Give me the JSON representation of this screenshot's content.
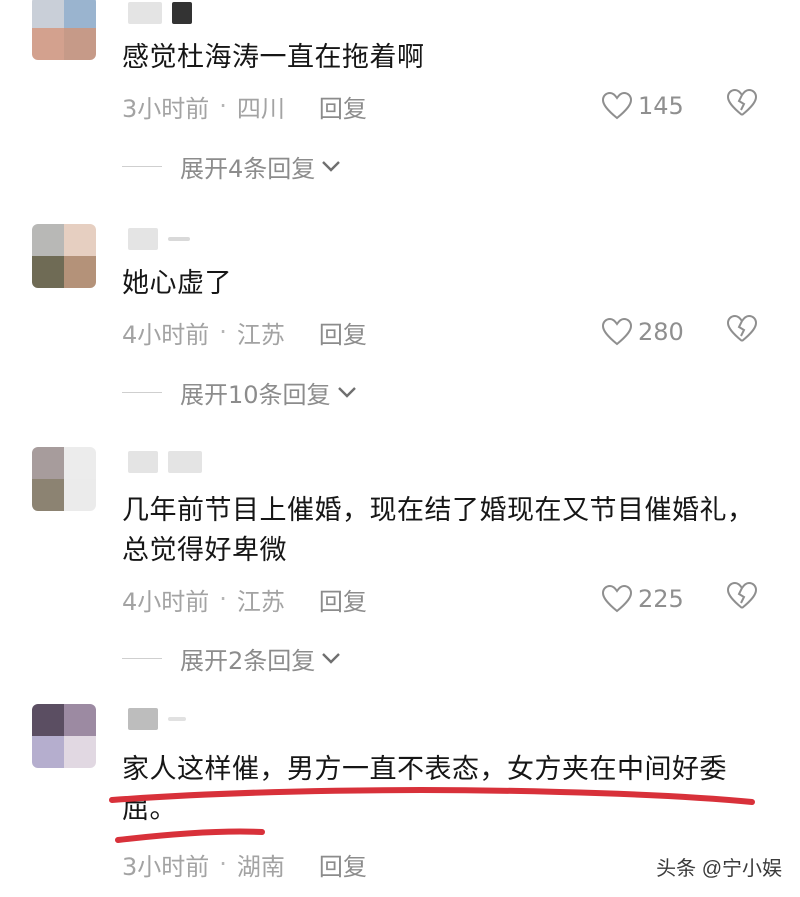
{
  "comments": [
    {
      "text": "感觉杜海涛一直在拖着啊",
      "time": "3小时前",
      "location": "四川",
      "reply_label": "回复",
      "likes": "145",
      "expand_label": "展开4条回复",
      "avatar_colors": [
        "#c9cfd8",
        "#9ab4cf",
        "#d3a18e",
        "#c69a88"
      ]
    },
    {
      "text": "她心虚了",
      "time": "4小时前",
      "location": "江苏",
      "reply_label": "回复",
      "likes": "280",
      "expand_label": "展开10条回复",
      "avatar_colors": [
        "#b8b8b6",
        "#e6cfc1",
        "#6f6b55",
        "#b49279"
      ]
    },
    {
      "text": "几年前节目上催婚，现在结了婚现在又节目催婚礼，总觉得好卑微",
      "time": "4小时前",
      "location": "江苏",
      "reply_label": "回复",
      "likes": "225",
      "expand_label": "展开2条回复",
      "avatar_colors": [
        "#a79c9c",
        "#ececec",
        "#8c8372",
        "#ebebeb"
      ]
    },
    {
      "text": "家人这样催，男方一直不表态，女方夹在中间好委屈。",
      "time": "3小时前",
      "location": "湖南",
      "reply_label": "回复",
      "avatar_colors": [
        "#5b4e62",
        "#9c8aa2",
        "#b5aece",
        "#e1d8e2"
      ]
    }
  ],
  "watermark": "头条 @宁小娱",
  "colors": {
    "highlight_line": "#d8313a",
    "meta_text": "#9a9a9a"
  }
}
